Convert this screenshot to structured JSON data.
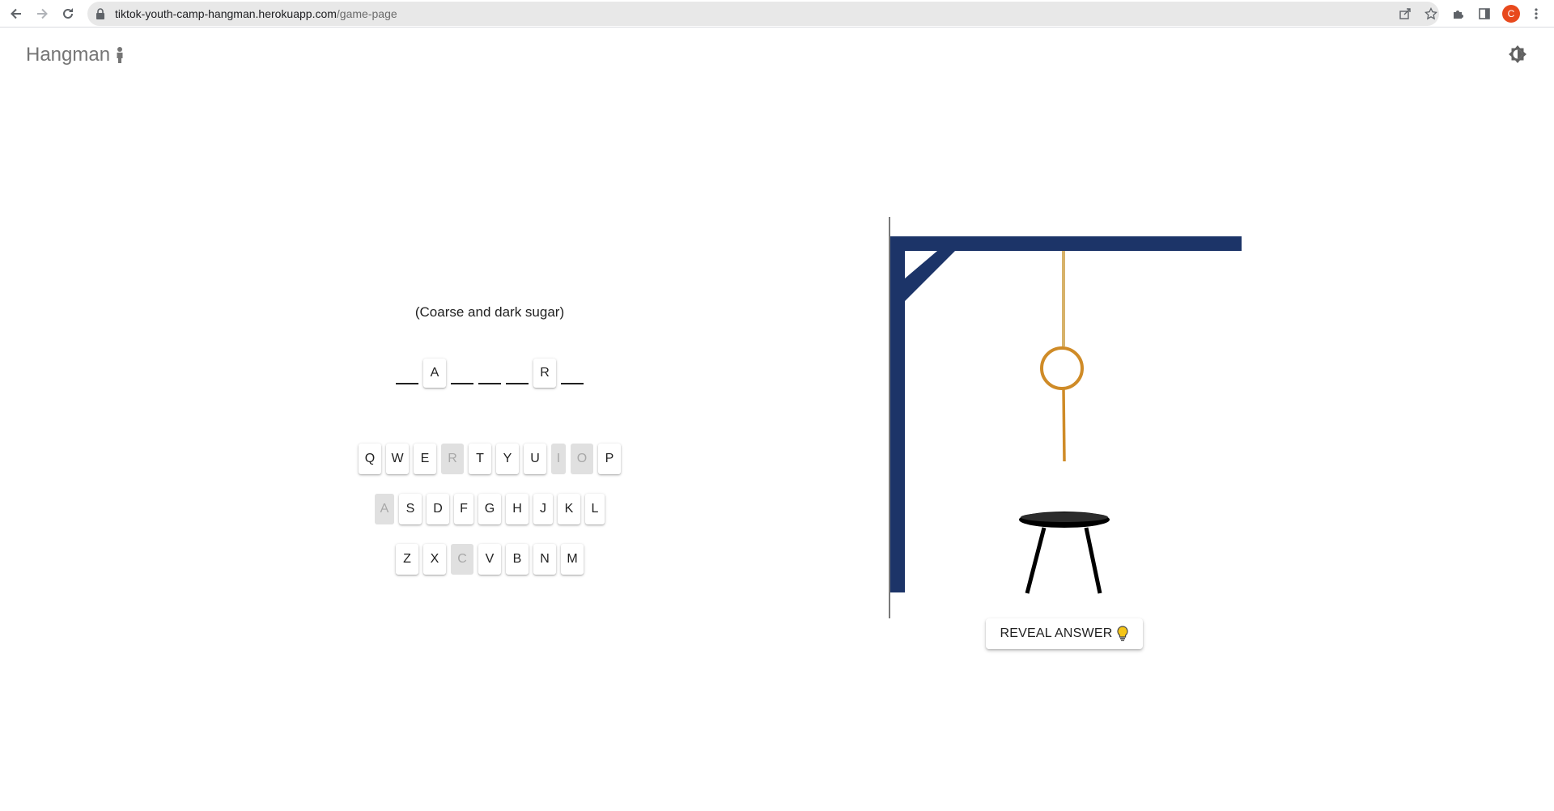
{
  "browser": {
    "url_domain": "tiktok-youth-camp-hangman.herokuapp.com",
    "url_path": "/game-page",
    "avatar_initial": "C",
    "icons": [
      "back-icon",
      "forward-icon",
      "reload-icon",
      "lock-icon",
      "share-icon",
      "star-icon",
      "extensions-icon",
      "side-panel-icon",
      "menu-icon"
    ]
  },
  "app": {
    "title": "Hangman",
    "title_icon": "person-icon",
    "theme_icon": "brightness-icon"
  },
  "game": {
    "hint": "(Coarse and dark sugar)",
    "word": [
      "",
      "A",
      "",
      "",
      "",
      "R",
      ""
    ],
    "keyboard": {
      "row1": [
        {
          "letter": "Q",
          "used": false
        },
        {
          "letter": "W",
          "used": false
        },
        {
          "letter": "E",
          "used": false
        },
        {
          "letter": "R",
          "used": true
        },
        {
          "letter": "T",
          "used": false
        },
        {
          "letter": "Y",
          "used": false
        },
        {
          "letter": "U",
          "used": false
        },
        {
          "letter": "I",
          "used": true
        },
        {
          "letter": "O",
          "used": true
        },
        {
          "letter": "P",
          "used": false
        }
      ],
      "row2": [
        {
          "letter": "A",
          "used": true
        },
        {
          "letter": "S",
          "used": false
        },
        {
          "letter": "D",
          "used": false
        },
        {
          "letter": "F",
          "used": false
        },
        {
          "letter": "G",
          "used": false
        },
        {
          "letter": "H",
          "used": false
        },
        {
          "letter": "J",
          "used": false
        },
        {
          "letter": "K",
          "used": false
        },
        {
          "letter": "L",
          "used": false
        }
      ],
      "row3": [
        {
          "letter": "Z",
          "used": false
        },
        {
          "letter": "X",
          "used": false
        },
        {
          "letter": "C",
          "used": true
        },
        {
          "letter": "V",
          "used": false
        },
        {
          "letter": "B",
          "used": false
        },
        {
          "letter": "N",
          "used": false
        },
        {
          "letter": "M",
          "used": false
        }
      ]
    },
    "reveal_button": "REVEAL ANSWER",
    "reveal_icon": "lightbulb-icon",
    "colors": {
      "gallows": "#1c3468",
      "rope": "#d7b26a",
      "noose": "#cf8b27",
      "stool": "#000000"
    }
  }
}
